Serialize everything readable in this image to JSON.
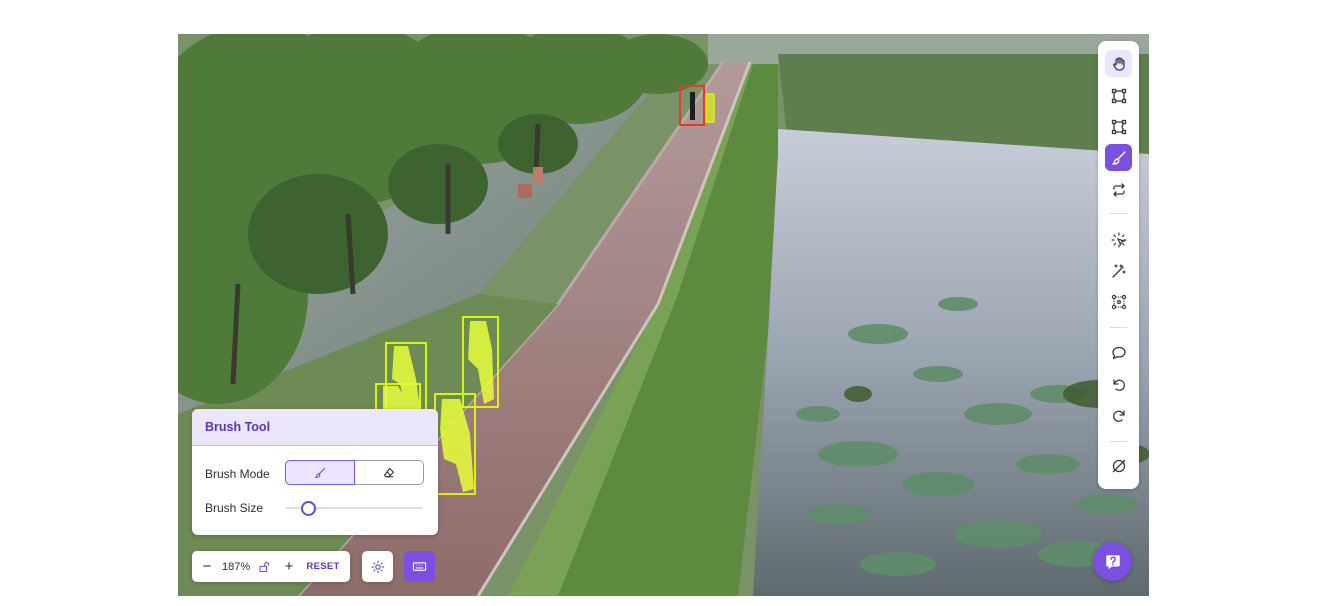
{
  "brush_panel": {
    "title": "Brush Tool",
    "mode_label": "Brush Mode",
    "size_label": "Brush Size",
    "modes": [
      "brush-icon",
      "eraser-icon"
    ],
    "selected_mode": "brush",
    "size_fraction": 0.16
  },
  "zoom": {
    "level": "187%",
    "reset_label": "RESET"
  },
  "toolbar": {
    "tools": [
      "hand-icon",
      "bounding-box-icon",
      "polygon-icon",
      "brush-icon",
      "swap-icon",
      "smart-select-icon",
      "magic-wand-icon",
      "keypoint-icon",
      "comment-icon",
      "undo-icon",
      "redo-icon",
      "clear-icon"
    ],
    "active_tool": "brush-icon"
  },
  "colors": {
    "accent": "#7b4fe0",
    "annotation_box": "#d9f20f",
    "selected_box": "#e03a2c"
  }
}
